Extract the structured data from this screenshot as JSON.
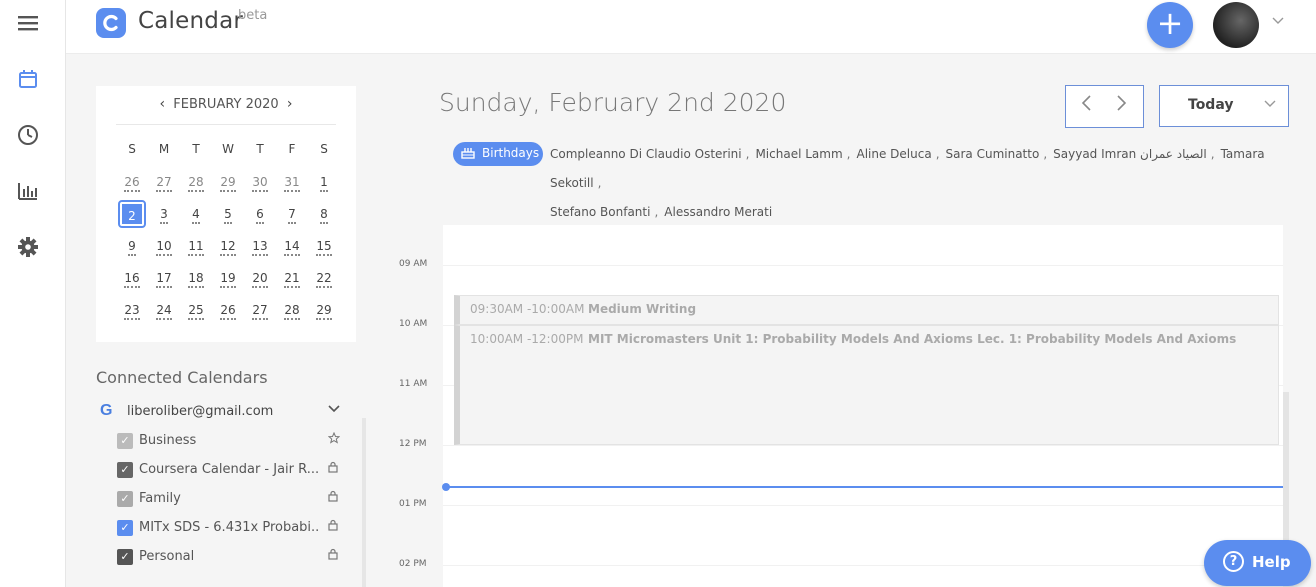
{
  "app": {
    "title": "Calendar",
    "beta": "beta"
  },
  "rail": [
    {
      "icon": "menu-icon"
    },
    {
      "icon": "calendar-icon",
      "active": true
    },
    {
      "icon": "clock-icon"
    },
    {
      "icon": "stats-icon"
    },
    {
      "icon": "gear-icon"
    }
  ],
  "header": {
    "add_label": "+",
    "avatar": "user-avatar"
  },
  "mini_calendar": {
    "month_label": "FEBRUARY 2020",
    "prev": "‹",
    "next": "›",
    "weekdays": [
      "S",
      "M",
      "T",
      "W",
      "T",
      "F",
      "S"
    ],
    "weeks": [
      [
        "26",
        "27",
        "28",
        "29",
        "30",
        "31",
        "1"
      ],
      [
        "2",
        "3",
        "4",
        "5",
        "6",
        "7",
        "8"
      ],
      [
        "9",
        "10",
        "11",
        "12",
        "13",
        "14",
        "15"
      ],
      [
        "16",
        "17",
        "18",
        "19",
        "20",
        "21",
        "22"
      ],
      [
        "23",
        "24",
        "25",
        "26",
        "27",
        "28",
        "29"
      ]
    ],
    "selected": "2"
  },
  "connected": {
    "title": "Connected Calendars",
    "account": "liberoliber@gmail.com",
    "calendars": [
      {
        "label": "Business",
        "color": "#bbbbbb",
        "checked": true,
        "icon": "star-icon"
      },
      {
        "label": "Coursera Calendar - Jair R...",
        "color": "#666666",
        "checked": true,
        "icon": "lock-icon"
      },
      {
        "label": "Family",
        "color": "#aaaaaa",
        "checked": true,
        "icon": "lock-icon"
      },
      {
        "label": "MITx SDS - 6.431x Probabi...",
        "color": "#5b8def",
        "checked": true,
        "icon": "lock-icon"
      },
      {
        "label": "Personal",
        "color": "#555555",
        "checked": true,
        "icon": "lock-icon"
      }
    ]
  },
  "main": {
    "date_title": "Sunday, February 2nd 2020",
    "today_label": "Today",
    "birthdays_label": "Birthdays",
    "birthdays": [
      "Compleanno Di Claudio Osterini",
      "Michael Lamm",
      "Aline Deluca",
      "Sara Cuminatto",
      "Sayyad Imran الصياد عمران",
      "Tamara Sekotill",
      "Stefano Bonfanti",
      "Alessandro Merati"
    ],
    "times": [
      "09 AM",
      "10 AM",
      "11 AM",
      "12 PM",
      "01 PM",
      "02 PM"
    ],
    "events": [
      {
        "time": "09:30AM -10:00AM",
        "title": "Medium Writing"
      },
      {
        "time": "10:00AM -12:00PM",
        "title": "MIT Micromasters Unit 1: Probability Models And Axioms Lec. 1: Probability Models And Axioms"
      }
    ]
  },
  "help": {
    "label": "Help"
  }
}
